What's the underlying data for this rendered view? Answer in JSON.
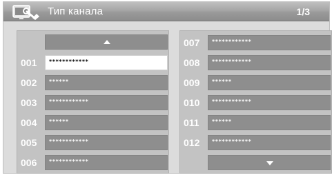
{
  "header": {
    "title": "Тип канала",
    "page_indicator": "1/3",
    "icon": "tv-settings-icon"
  },
  "left_list": {
    "scroll_up_icon": "triangle-up-icon",
    "items": [
      {
        "number": "001",
        "name": "************",
        "selected": true
      },
      {
        "number": "002",
        "name": "******",
        "selected": false
      },
      {
        "number": "003",
        "name": "************",
        "selected": false
      },
      {
        "number": "004",
        "name": "******",
        "selected": false
      },
      {
        "number": "005",
        "name": "************",
        "selected": false
      },
      {
        "number": "006",
        "name": "************",
        "selected": false
      }
    ]
  },
  "right_list": {
    "scroll_down_icon": "triangle-down-icon",
    "items": [
      {
        "number": "007",
        "name": "************",
        "selected": false
      },
      {
        "number": "008",
        "name": "************",
        "selected": false
      },
      {
        "number": "009",
        "name": "******",
        "selected": false
      },
      {
        "number": "010",
        "name": "************",
        "selected": false
      },
      {
        "number": "011",
        "name": "******",
        "selected": false
      },
      {
        "number": "012",
        "name": "************",
        "selected": false
      }
    ]
  }
}
